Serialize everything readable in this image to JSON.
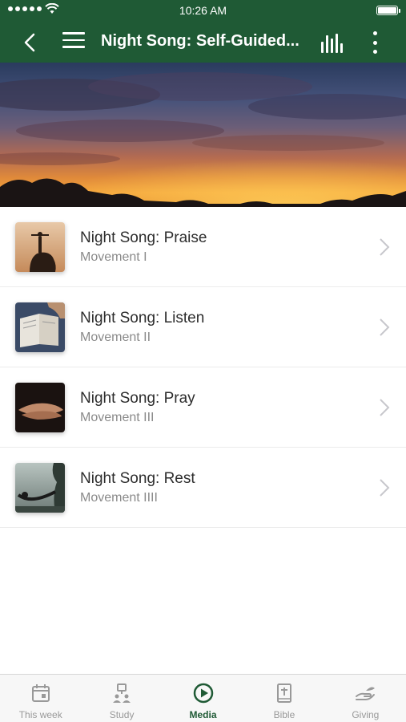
{
  "status_bar": {
    "time": "10:26 AM"
  },
  "header": {
    "title": "Night Song: Self-Guided..."
  },
  "tracks": [
    {
      "title": "Night Song: Praise",
      "subtitle": "Movement I"
    },
    {
      "title": "Night Song: Listen",
      "subtitle": "Movement II"
    },
    {
      "title": "Night Song: Pray",
      "subtitle": "Movement III"
    },
    {
      "title": "Night Song: Rest",
      "subtitle": "Movement IIII"
    }
  ],
  "tabs": [
    {
      "label": "This week",
      "icon": "calendar-icon"
    },
    {
      "label": "Study",
      "icon": "study-group-icon"
    },
    {
      "label": "Media",
      "icon": "play-circle-icon",
      "active": true
    },
    {
      "label": "Bible",
      "icon": "bible-icon"
    },
    {
      "label": "Giving",
      "icon": "giving-hand-icon"
    }
  ],
  "colors": {
    "header_bg": "#1f5a35",
    "active_tab": "#1f5a35",
    "inactive_tab": "#999999"
  }
}
